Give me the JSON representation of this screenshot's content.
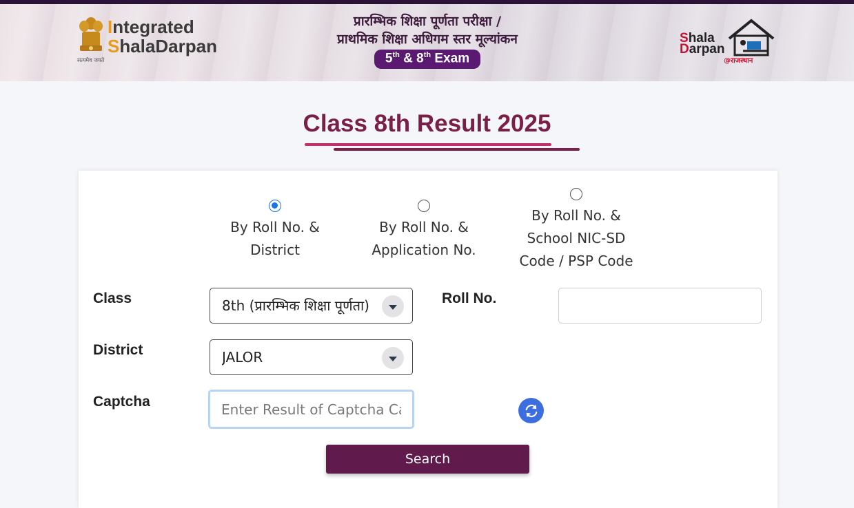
{
  "header": {
    "brand_line1_first": "I",
    "brand_line1_rest": "ntegrated",
    "brand_line2_first": "S",
    "brand_line2_mid": "hala",
    "brand_line2_rest": "Darpan",
    "emblem_caption": "सत्यमेव जयते",
    "title_hindi_line1": "प्रारम्भिक शिक्षा पूर्णता परीक्षा /",
    "title_hindi_line2": "प्राथमिक शिक्षा अधिगम स्तर मूल्यांकन",
    "exam_pill_5": "5",
    "exam_pill_8": "8",
    "exam_pill_sup": "th",
    "exam_pill_amp": "&",
    "exam_pill_word": "Exam",
    "right_logo_line1_s": "S",
    "right_logo_line1_rest": "hala",
    "right_logo_line2_s": "D",
    "right_logo_line2_rest": "arpan",
    "right_logo_sub": "@राजस्थान"
  },
  "page_title": "Class 8th Result 2025",
  "search_modes": [
    {
      "line1": "By Roll No. &",
      "line2": "District",
      "line3": "",
      "checked": true
    },
    {
      "line1": "By Roll No. &",
      "line2": "Application No.",
      "line3": "",
      "checked": false
    },
    {
      "line1": "By Roll No. &",
      "line2": "School NIC-SD",
      "line3": "Code / PSP Code",
      "checked": false
    }
  ],
  "form": {
    "class_label": "Class",
    "class_value": "8th (प्रारम्भिक शिक्षा पूर्णता)",
    "roll_label": "Roll No.",
    "roll_value": "",
    "district_label": "District",
    "district_value": "JALOR",
    "captcha_label": "Captcha",
    "captcha_placeholder": "Enter Result of Captcha Calculation",
    "search_label": "Search"
  },
  "colors": {
    "title": "#7a2048",
    "button": "#611a4c",
    "accent_pill": "#5b1a72",
    "radio_selected": "#1a73e8",
    "refresh": "#3d6ee0"
  },
  "icons": {
    "emblem": "ashoka-emblem-icon",
    "house": "house-logo-icon",
    "refresh": "refresh-icon",
    "caret": "chevron-down-icon"
  }
}
